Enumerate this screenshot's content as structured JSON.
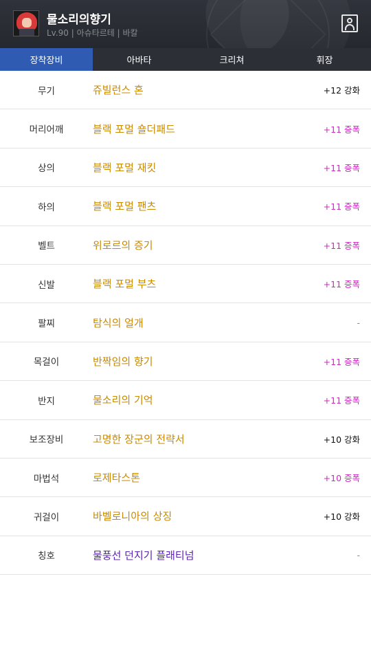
{
  "header": {
    "name": "물소리의향기",
    "info": "Lv.90 | 아슈타르테 | 바칼"
  },
  "tabs": [
    {
      "label": "장착장비",
      "active": true
    },
    {
      "label": "아바타",
      "active": false
    },
    {
      "label": "크리쳐",
      "active": false
    },
    {
      "label": "휘장",
      "active": false
    }
  ],
  "equipment": [
    {
      "slot": "무기",
      "item": "쥬빌런스 혼",
      "enhance": "+12 강화",
      "enhance_color": "#111111"
    },
    {
      "slot": "머리어깨",
      "item": "블랙 포멀 숄더패드",
      "enhance": "+11 증폭",
      "enhance_color": "#d025c6"
    },
    {
      "slot": "상의",
      "item": "블랙 포멀 재킷",
      "enhance": "+11 증폭",
      "enhance_color": "#d025c6"
    },
    {
      "slot": "하의",
      "item": "블랙 포멀 팬츠",
      "enhance": "+11 증폭",
      "enhance_color": "#d025c6"
    },
    {
      "slot": "벨트",
      "item": "위로르의 증기",
      "enhance": "+11 증폭",
      "enhance_color": "#d025c6"
    },
    {
      "slot": "신발",
      "item": "블랙 포멀 부츠",
      "enhance": "+11 증폭",
      "enhance_color": "#d025c6"
    },
    {
      "slot": "팔찌",
      "item": "탐식의 얼개",
      "enhance": "-",
      "enhance_color": "#888888"
    },
    {
      "slot": "목걸이",
      "item": "반짝임의 향기",
      "enhance": "+11 증폭",
      "enhance_color": "#d025c6"
    },
    {
      "slot": "반지",
      "item": "물소리의 기억",
      "enhance": "+11 증폭",
      "enhance_color": "#d025c6"
    },
    {
      "slot": "보조장비",
      "item": "고명한 장군의 전략서",
      "enhance": "+10 강화",
      "enhance_color": "#111111"
    },
    {
      "slot": "마법석",
      "item": "로제타스톤",
      "enhance": "+10 증폭",
      "enhance_color": "#d025c6"
    },
    {
      "slot": "귀걸이",
      "item": "바벨로니아의 상징",
      "enhance": "+10 강화",
      "enhance_color": "#111111"
    },
    {
      "slot": "칭호",
      "item": "물풍선 던지기 플래티넘",
      "enhance": "-",
      "enhance_color": "#888888"
    }
  ],
  "colors": {
    "item_epic": "#c98a00",
    "item_title": "#5b21b6",
    "tab_active": "#2f5cb2",
    "header_bg": "#2a2d35"
  },
  "icons": {
    "avatar": "character-portrait",
    "profile": "profile-icon"
  }
}
